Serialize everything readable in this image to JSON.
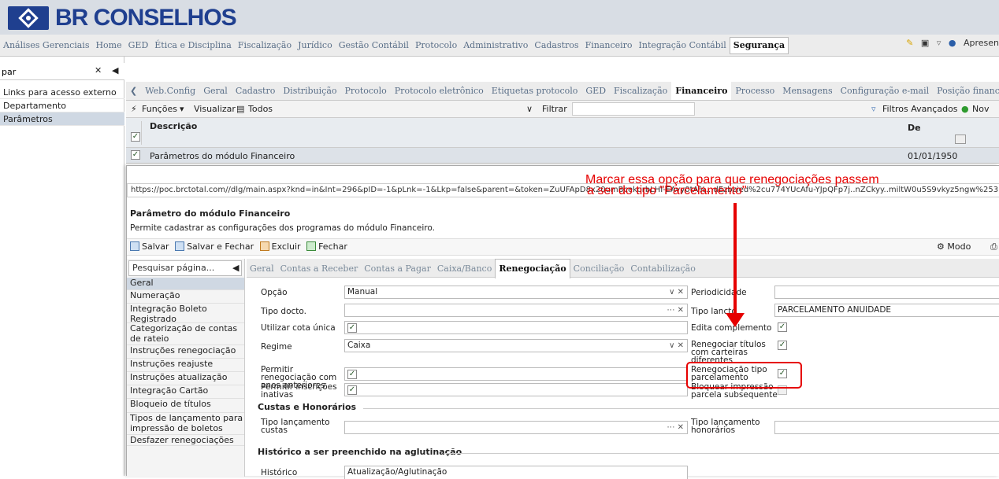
{
  "brand": {
    "name": "BR CONSELHOS"
  },
  "menu": {
    "items": [
      "Análises Gerenciais",
      "Home",
      "GED",
      "Ética e Disciplina",
      "Fiscalização",
      "Jurídico",
      "Gestão Contábil",
      "Protocolo",
      "Administrativo",
      "Cadastros",
      "Financeiro",
      "Integração Contábil",
      "Segurança"
    ],
    "active": "Segurança",
    "right_label": "Apresen"
  },
  "left_panel": {
    "search_value": "par",
    "items": [
      "Links para acesso externo",
      "Departamento",
      "Parâmetros"
    ]
  },
  "tabs": {
    "items": [
      "Web.Config",
      "Geral",
      "Cadastro",
      "Distribuição",
      "Protocolo",
      "Protocolo eletrônico",
      "Etiquetas protocolo",
      "GED",
      "Fiscalização",
      "Financeiro",
      "Processo",
      "Mensagens",
      "Configuração e-mail",
      "Posição financeir"
    ],
    "active": "Financeiro"
  },
  "toolbar": {
    "funcoes": "Funções",
    "visualizar": "Visualizar",
    "todos": "Todos",
    "filtrar": "Filtrar",
    "filtros_avancados": "Filtros Avançados",
    "novo": "Nov"
  },
  "grid": {
    "col_descricao": "Descrição",
    "col_de": "De",
    "row_descricao": "Parâmetros do módulo Financeiro",
    "row_de": "01/01/1950"
  },
  "dialog": {
    "url": "https://poc.brctotal.com//dlg/main.aspx?knd=in&Int=296&pID=-1&pLnk=-1&Lkp=false&parent=&token=ZuUFApD8x20umBcekorbLHI-EAvy0tA%...dEzbzied%2cu774YUcAfu-YJpQFp7j..nZCkyy..miltW0u5S9vkyz5ngw%253D%253D&syst",
    "title": "Parâmetro do módulo Financeiro",
    "subtitle": "Permite cadastrar as configurações dos programas do módulo Financeiro.",
    "actions": {
      "salvar": "Salvar",
      "salvar_fechar": "Salvar e Fechar",
      "excluir": "Excluir",
      "fechar": "Fechar",
      "modo_design": "Modo Design"
    },
    "page_search": "Pesquisar página...",
    "nav": [
      "Geral",
      "Numeração",
      "Integração Boleto Registrado",
      "Categorização de contas de rateio",
      "Instruções renegociação",
      "Instruções reajuste",
      "Instruções atualização",
      "Integração Cartão",
      "Bloqueio de títulos",
      "Tipos de lançamento para impressão de boletos",
      "Desfazer renegociações"
    ],
    "tabs": [
      "Geral",
      "Contas a Receber",
      "Contas a Pagar",
      "Caixa/Banco",
      "Renegociação",
      "Conciliação",
      "Contabilização"
    ],
    "active_tab": "Renegociação",
    "form": {
      "opcao_label": "Opção",
      "opcao_value": "Manual",
      "tipo_docto_label": "Tipo docto.",
      "tipo_docto_value": "",
      "cota_unica_label": "Utilizar cota única",
      "regime_label": "Regime",
      "regime_value": "Caixa",
      "permitir_reneg_label": "Permitir renegociação com anos anteriores",
      "permitir_insc_label": "Permitir inscrições inativas",
      "periodicidade_label": "Periodicidade",
      "periodicidade_value": "",
      "tipo_lancto_label": "Tipo lancto",
      "tipo_lancto_value": "PARCELAMENTO ANUIDADE",
      "edita_compl_label": "Edita complemento",
      "reneg_carteiras_label": "Renegociar títulos com carteiras diferentes",
      "reneg_tipo_parc_label": "Renegociação tipo parcelamento",
      "bloquear_label": "Bloquear impressão parcela subsequente",
      "custas_section": "Custas e Honorários",
      "tipo_lanc_custas_label": "Tipo lançamento custas",
      "tipo_lanc_honor_label": "Tipo lançamento honorários",
      "historico_section": "Histórico a ser preenchido na aglutinação",
      "historico_label": "Histórico",
      "historico_value": "Atualização/Aglutinação"
    }
  },
  "annotation": {
    "text": "Marcar essa opção para que renegociações passem a ser do tipo \"Parcelamento\"",
    "color": "#e60000"
  }
}
